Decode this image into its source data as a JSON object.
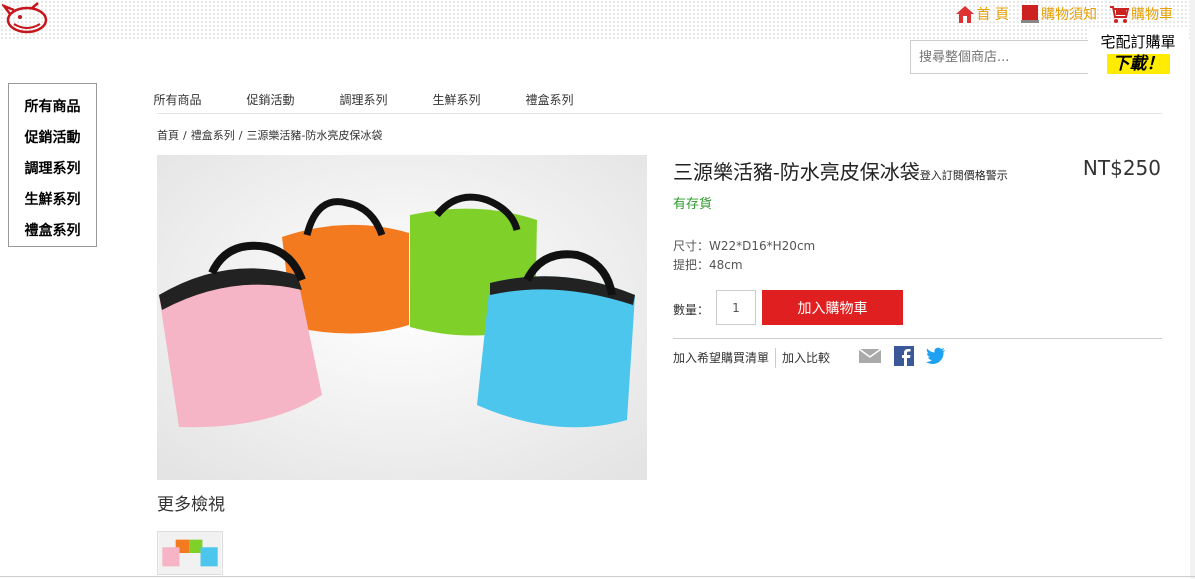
{
  "header": {
    "links": [
      {
        "label": "首 頁",
        "icon": "home-icon"
      },
      {
        "label": "購物須知",
        "icon": "notice-icon"
      },
      {
        "label": "購物車",
        "icon": "cart-icon"
      }
    ],
    "search_placeholder": "搜尋整個商店...",
    "promo": {
      "title": "宅配訂購單",
      "download": "下載！"
    }
  },
  "sidebar": {
    "items": [
      "所有商品",
      "促銷活動",
      "調理系列",
      "生鮮系列",
      "禮盒系列"
    ]
  },
  "nav": {
    "items": [
      "所有商品",
      "促銷活動",
      "調理系列",
      "生鮮系列",
      "禮盒系列"
    ]
  },
  "breadcrumb": [
    "首頁",
    "禮盒系列",
    "三源樂活豬-防水亮皮保冰袋"
  ],
  "product": {
    "title": "三源樂活豬-防水亮皮保冰袋",
    "login_link": "登入訂閱價格警示",
    "price": "NT$250",
    "stock": "有存貨",
    "spec_size": "尺寸：W22*D16*H20cm",
    "spec_handle": "提把：48cm",
    "qty_label": "數量：",
    "qty_value": "1",
    "add_to_cart": "加入購物車",
    "wishlist": "加入希望購買清單",
    "compare": "加入比較",
    "more_views": "更多檢視"
  },
  "colors": {
    "accent_red": "#e02020",
    "stock_green": "#2d9b2d",
    "toplink_orange": "#e8a000",
    "promo_yellow": "#ffec00",
    "facebook_blue": "#3b5998",
    "twitter_blue": "#1da1f2"
  }
}
